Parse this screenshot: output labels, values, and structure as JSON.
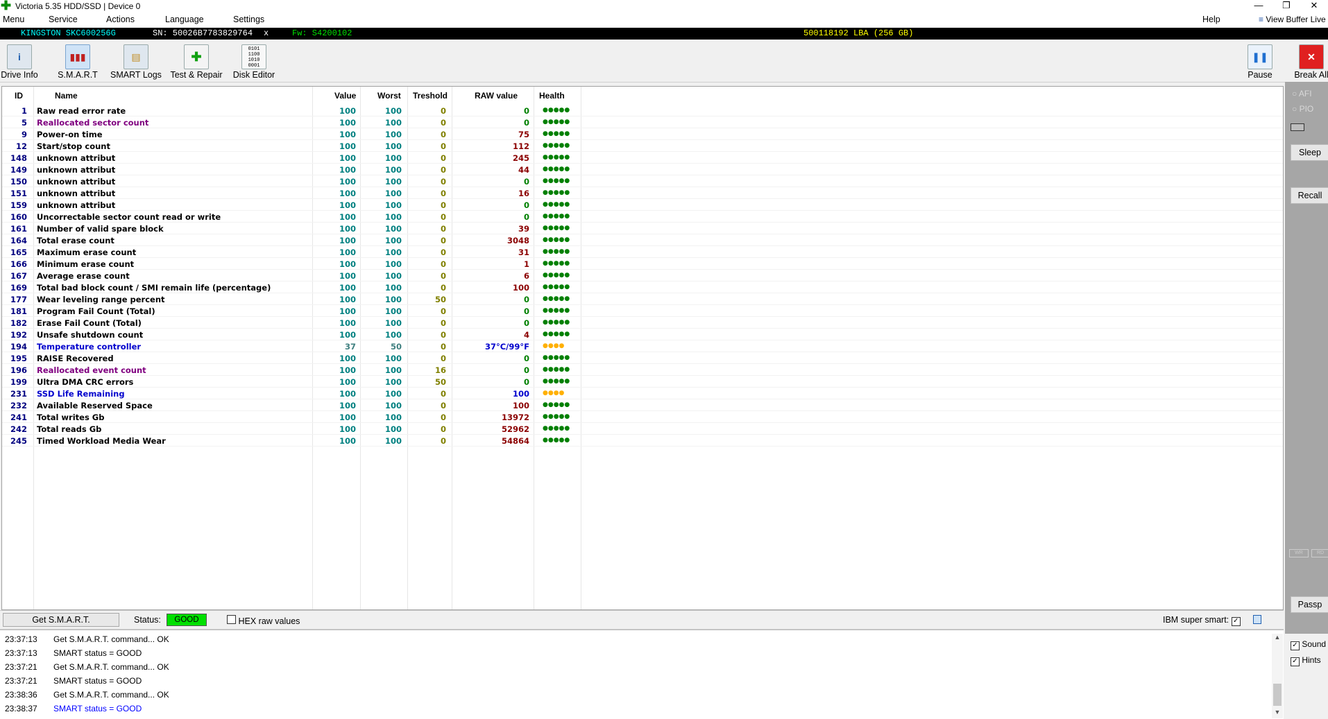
{
  "window": {
    "title": "Victoria 5.35 HDD/SSD | Device 0",
    "minimize": "—",
    "restore": "❐",
    "close": "✕"
  },
  "menu": {
    "items": [
      "Menu",
      "Service",
      "Actions",
      "Language",
      "Settings"
    ],
    "help": "Help",
    "view_buffer": "View Buffer Live"
  },
  "device": {
    "model": "KINGSTON SKC600256G",
    "serial": "SN: 50026B7783829764",
    "close_x": "x",
    "firmware": "Fw: S4200102",
    "capacity": "500118192 LBA (256 GB)"
  },
  "toolbar": {
    "buttons": [
      {
        "label": "Drive Info",
        "icon": "info-icon"
      },
      {
        "label": "S.M.A.R.T",
        "icon": "smart-chart-icon"
      },
      {
        "label": "SMART Logs",
        "icon": "logs-folder-icon"
      },
      {
        "label": "Test & Repair",
        "icon": "first-aid-icon"
      },
      {
        "label": "Disk Editor",
        "icon": "hex-editor-icon"
      }
    ],
    "pause": "Pause",
    "break_all": "Break All"
  },
  "table": {
    "headers": {
      "id": "ID",
      "name": "Name",
      "value": "Value",
      "worst": "Worst",
      "treshold": "Treshold",
      "raw": "RAW value",
      "health": "Health"
    },
    "rows": [
      {
        "id": "1",
        "name": "Raw read error rate",
        "value": "100",
        "worst": "100",
        "treshold": "0",
        "raw": "0",
        "health": "●●●●●"
      },
      {
        "id": "5",
        "name": "Reallocated sector count",
        "value": "100",
        "worst": "100",
        "treshold": "0",
        "raw": "0",
        "health": "●●●●●"
      },
      {
        "id": "9",
        "name": "Power-on time",
        "value": "100",
        "worst": "100",
        "treshold": "0",
        "raw": "75",
        "health": "●●●●●"
      },
      {
        "id": "12",
        "name": "Start/stop count",
        "value": "100",
        "worst": "100",
        "treshold": "0",
        "raw": "112",
        "health": "●●●●●"
      },
      {
        "id": "148",
        "name": "unknown attribut",
        "value": "100",
        "worst": "100",
        "treshold": "0",
        "raw": "245",
        "health": "●●●●●"
      },
      {
        "id": "149",
        "name": "unknown attribut",
        "value": "100",
        "worst": "100",
        "treshold": "0",
        "raw": "44",
        "health": "●●●●●"
      },
      {
        "id": "150",
        "name": "unknown attribut",
        "value": "100",
        "worst": "100",
        "treshold": "0",
        "raw": "0",
        "health": "●●●●●"
      },
      {
        "id": "151",
        "name": "unknown attribut",
        "value": "100",
        "worst": "100",
        "treshold": "0",
        "raw": "16",
        "health": "●●●●●"
      },
      {
        "id": "159",
        "name": "unknown attribut",
        "value": "100",
        "worst": "100",
        "treshold": "0",
        "raw": "0",
        "health": "●●●●●"
      },
      {
        "id": "160",
        "name": "Uncorrectable sector count read or write",
        "value": "100",
        "worst": "100",
        "treshold": "0",
        "raw": "0",
        "health": "●●●●●"
      },
      {
        "id": "161",
        "name": "Number of valid spare block",
        "value": "100",
        "worst": "100",
        "treshold": "0",
        "raw": "39",
        "health": "●●●●●"
      },
      {
        "id": "164",
        "name": "Total erase count",
        "value": "100",
        "worst": "100",
        "treshold": "0",
        "raw": "3048",
        "health": "●●●●●"
      },
      {
        "id": "165",
        "name": "Maximum erase count",
        "value": "100",
        "worst": "100",
        "treshold": "0",
        "raw": "31",
        "health": "●●●●●"
      },
      {
        "id": "166",
        "name": "Minimum erase count",
        "value": "100",
        "worst": "100",
        "treshold": "0",
        "raw": "1",
        "health": "●●●●●"
      },
      {
        "id": "167",
        "name": "Average erase count",
        "value": "100",
        "worst": "100",
        "treshold": "0",
        "raw": "6",
        "health": "●●●●●"
      },
      {
        "id": "169",
        "name": "Total bad block count / SMI remain life (percentage)",
        "value": "100",
        "worst": "100",
        "treshold": "0",
        "raw": "100",
        "health": "●●●●●"
      },
      {
        "id": "177",
        "name": "Wear leveling range percent",
        "value": "100",
        "worst": "100",
        "treshold": "50",
        "raw": "0",
        "health": "●●●●●"
      },
      {
        "id": "181",
        "name": "Program Fail Count (Total)",
        "value": "100",
        "worst": "100",
        "treshold": "0",
        "raw": "0",
        "health": "●●●●●"
      },
      {
        "id": "182",
        "name": "Erase Fail Count (Total)",
        "value": "100",
        "worst": "100",
        "treshold": "0",
        "raw": "0",
        "health": "●●●●●"
      },
      {
        "id": "192",
        "name": "Unsafe shutdown count",
        "value": "100",
        "worst": "100",
        "treshold": "0",
        "raw": "4",
        "health": "●●●●●"
      },
      {
        "id": "194",
        "name": "Temperature controller",
        "value": "37",
        "worst": "50",
        "treshold": "0",
        "raw": "37°C/99°F",
        "health": "●●●●"
      },
      {
        "id": "195",
        "name": "RAISE Recovered",
        "value": "100",
        "worst": "100",
        "treshold": "0",
        "raw": "0",
        "health": "●●●●●"
      },
      {
        "id": "196",
        "name": "Reallocated event count",
        "value": "100",
        "worst": "100",
        "treshold": "16",
        "raw": "0",
        "health": "●●●●●"
      },
      {
        "id": "199",
        "name": "Ultra DMA CRC errors",
        "value": "100",
        "worst": "100",
        "treshold": "50",
        "raw": "0",
        "health": "●●●●●"
      },
      {
        "id": "231",
        "name": "SSD Life Remaining",
        "value": "100",
        "worst": "100",
        "treshold": "0",
        "raw": "100",
        "health": "●●●●"
      },
      {
        "id": "232",
        "name": "Available Reserved Space",
        "value": "100",
        "worst": "100",
        "treshold": "0",
        "raw": "100",
        "health": "●●●●●"
      },
      {
        "id": "241",
        "name": "Total writes Gb",
        "value": "100",
        "worst": "100",
        "treshold": "0",
        "raw": "13972",
        "health": "●●●●●"
      },
      {
        "id": "242",
        "name": "Total reads Gb",
        "value": "100",
        "worst": "100",
        "treshold": "0",
        "raw": "52962",
        "health": "●●●●●"
      },
      {
        "id": "245",
        "name": "Timed Workload Media Wear",
        "value": "100",
        "worst": "100",
        "treshold": "0",
        "raw": "54864",
        "health": "●●●●●"
      }
    ]
  },
  "right_panel": {
    "afi": "AFI",
    "pio": "PIO",
    "sleep": "Sleep",
    "recall": "Recall",
    "wr": "WR",
    "rd": "RD",
    "passp": "Passp",
    "sound": "Sound",
    "hints": "Hints"
  },
  "bottom": {
    "get_smart": "Get S.M.A.R.T.",
    "status_label": "Status:",
    "status_value": "GOOD",
    "hex_raw": "HEX raw values",
    "ibm_super_smart": "IBM super smart:",
    "check_mark": "✓"
  },
  "log": [
    {
      "time": "23:37:13",
      "msg": "Get S.M.A.R.T. command... OK",
      "color": "#000000"
    },
    {
      "time": "23:37:13",
      "msg": "SMART status = GOOD",
      "color": "#000000"
    },
    {
      "time": "23:37:21",
      "msg": "Get S.M.A.R.T. command... OK",
      "color": "#000000"
    },
    {
      "time": "23:37:21",
      "msg": "SMART status = GOOD",
      "color": "#000000"
    },
    {
      "time": "23:38:36",
      "msg": "Get S.M.A.R.T. command... OK",
      "color": "#000000"
    },
    {
      "time": "23:38:37",
      "msg": "SMART status = GOOD",
      "color": "#0000ff"
    }
  ],
  "colors": {
    "name_normal": "#000000",
    "name_highlight_purple": "#800080",
    "name_highlight_blue": "#0000cd",
    "health_good": "#008000",
    "health_warn": "#ffb000",
    "status_good_bg": "#00e000"
  }
}
